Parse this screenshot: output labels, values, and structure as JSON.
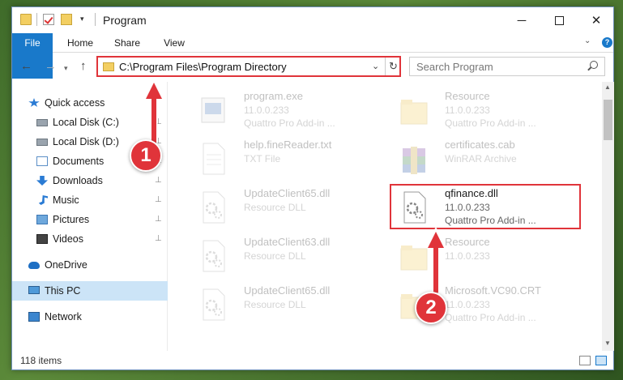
{
  "window": {
    "title": "Program",
    "minimize_glyph": "─",
    "close_glyph": "✕"
  },
  "quick_access_toolbar": {
    "dropdown_glyph": "▾"
  },
  "ribbon": {
    "tabs": [
      "File",
      "Home",
      "Share",
      "View"
    ],
    "expand_glyph": "⌄",
    "help_glyph": "?"
  },
  "navigation": {
    "back_glyph": "←",
    "forward_glyph": "→",
    "history_glyph": "▾",
    "up_glyph": "↑",
    "address_path": "C:\\Program Files\\Program Directory",
    "address_dropdown_glyph": "⌄",
    "refresh_glyph": "↻",
    "search_placeholder": "Search Program"
  },
  "sidebar": {
    "pin_glyph": "📌",
    "items": [
      {
        "label": "Quick access",
        "icon": "star-icon",
        "pinned": false
      },
      {
        "label": "Local Disk (C:)",
        "icon": "drive-icon",
        "pinned": true
      },
      {
        "label": "Local Disk (D:)",
        "icon": "drive-icon",
        "pinned": true
      },
      {
        "label": "Documents",
        "icon": "documents-icon",
        "pinned": true
      },
      {
        "label": "Downloads",
        "icon": "download-icon",
        "pinned": true
      },
      {
        "label": "Music",
        "icon": "music-icon",
        "pinned": true
      },
      {
        "label": "Pictures",
        "icon": "pictures-icon",
        "pinned": true
      },
      {
        "label": "Videos",
        "icon": "videos-icon",
        "pinned": true
      },
      {
        "label": "OneDrive",
        "icon": "cloud-icon",
        "pinned": false
      },
      {
        "label": "This PC",
        "icon": "computer-icon",
        "pinned": false,
        "selected": true
      },
      {
        "label": "Network",
        "icon": "network-icon",
        "pinned": false
      }
    ]
  },
  "files": [
    {
      "name": "program.exe",
      "line1": "11.0.0.233",
      "line2": "Quattro Pro Add-in ...",
      "icon": "exe-icon",
      "faded": true
    },
    {
      "name": "Resource",
      "line1": "11.0.0.233",
      "line2": "Quattro Pro Add-in ...",
      "icon": "folder-icon",
      "faded": true
    },
    {
      "name": "help.fineReader.txt",
      "line1": "TXT File",
      "line2": "",
      "icon": "text-file-icon",
      "faded": true
    },
    {
      "name": "certificates.cab",
      "line1": "WinRAR Archive",
      "line2": "",
      "icon": "archive-icon",
      "faded": true
    },
    {
      "name": "UpdateClient65.dll",
      "line1": "Resource DLL",
      "line2": "",
      "icon": "dll-icon",
      "faded": true
    },
    {
      "name": "qfinance.dll",
      "line1": "11.0.0.233",
      "line2": "Quattro Pro Add-in ...",
      "icon": "dll-icon",
      "faded": false
    },
    {
      "name": "UpdateClient63.dll",
      "line1": "Resource DLL",
      "line2": "",
      "icon": "dll-icon",
      "faded": true
    },
    {
      "name": "Resource",
      "line1": "11.0.0.233",
      "line2": "",
      "icon": "folder-icon",
      "faded": true
    },
    {
      "name": "UpdateClient65.dll",
      "line1": "Resource DLL",
      "line2": "",
      "icon": "dll-icon",
      "faded": true
    },
    {
      "name": "Microsoft.VC90.CRT",
      "line1": "11.0.0.233",
      "line2": "Quattro Pro Add-in ...",
      "icon": "folder-icon",
      "faded": true
    }
  ],
  "status": {
    "item_count": "118 items"
  },
  "callouts": {
    "step1": "1",
    "step2": "2"
  },
  "colors": {
    "accent": "#1979ca",
    "highlight": "#e0343a",
    "selection": "#cce4f7",
    "folder": "#f3cf62"
  }
}
